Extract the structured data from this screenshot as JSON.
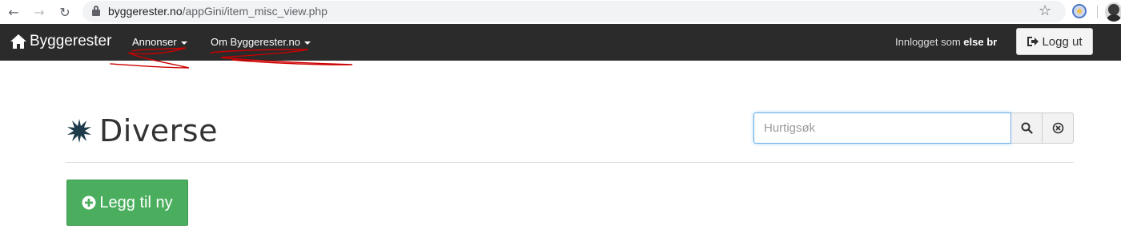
{
  "browser": {
    "url_host": "byggerester.no",
    "url_path": "/appGini/item_misc_view.php"
  },
  "navbar": {
    "brand": "Byggerester",
    "menus": [
      {
        "label": "Annonser"
      },
      {
        "label": "Om Byggerester.no"
      }
    ],
    "logged_in_prefix": "Innlogget som",
    "username": "else br",
    "logout_label": "Logg ut"
  },
  "page": {
    "title": "Diverse",
    "search_placeholder": "Hurtigsøk",
    "add_new_label": "Legg til ny"
  },
  "colors": {
    "navbar_bg": "#2b2b2b",
    "add_button": "#4bae5f",
    "annotation_red": "#cc0000",
    "search_focus": "#66afe9"
  },
  "icons": {
    "brand": "home-icon",
    "logout": "logout-icon",
    "title": "splat-icon",
    "search": "search-icon",
    "clear": "clear-icon",
    "add": "plus-circle-icon"
  }
}
